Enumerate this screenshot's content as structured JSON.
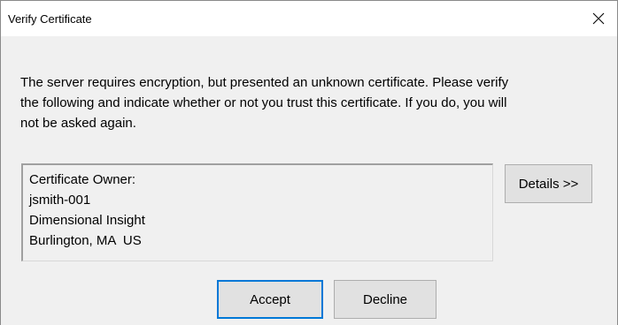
{
  "window": {
    "title": "Verify Certificate",
    "close_icon": "close-icon"
  },
  "message": "The server requires encryption, but presented an unknown certificate. Please verify the following and indicate whether or not you trust this certificate. If you do, you will not be asked again.",
  "certificate": {
    "lines": [
      "Certificate Owner:",
      "jsmith-001",
      "Dimensional Insight",
      "Burlington, MA  US"
    ]
  },
  "buttons": {
    "details": "Details >>",
    "accept": "Accept",
    "decline": "Decline"
  }
}
